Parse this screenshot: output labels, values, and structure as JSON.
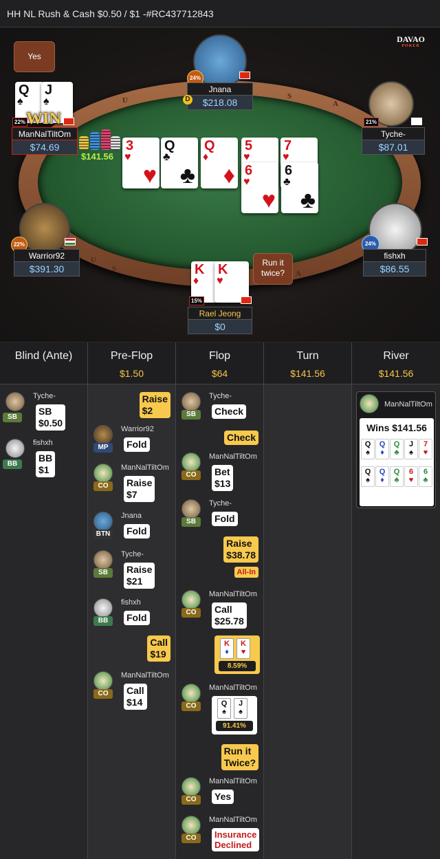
{
  "header": {
    "title": "HH NL Rush & Cash $0.50 / $1 -#RC437712843"
  },
  "logo": {
    "text": "DAVAO",
    "sub": "POKER"
  },
  "rail": {
    "letters": [
      "U",
      "S",
      "A",
      "U",
      "S",
      "A"
    ]
  },
  "board": [
    {
      "rank": "3",
      "suit": "♥",
      "color": "red"
    },
    {
      "rank": "Q",
      "suit": "♣",
      "color": "black"
    },
    {
      "rank": "Q",
      "suit": "♦",
      "color": "red"
    },
    {
      "rank": "5",
      "suit": "♥",
      "color": "red"
    },
    {
      "rank": "7",
      "suit": "♥",
      "color": "red"
    },
    {
      "rank": "6",
      "suit": "♥",
      "color": "red"
    },
    {
      "rank": "6",
      "suit": "♣",
      "color": "black"
    }
  ],
  "seats": {
    "mannal": {
      "name": "ManNalTiltOm",
      "stack": "$74.69",
      "pct": "22%",
      "cards": [
        {
          "rank": "Q",
          "suit": "♠"
        },
        {
          "rank": "J",
          "suit": "♠"
        }
      ],
      "win": "WIN",
      "bubble": "Yes"
    },
    "jnana": {
      "name": "Jnana",
      "stack": "$218.08",
      "pct": "24%"
    },
    "tyche": {
      "name": "Tyche-",
      "stack": "$87.01",
      "pct": "21%"
    },
    "warrior": {
      "name": "Warrior92",
      "stack": "$391.30",
      "pct": "22%"
    },
    "fishxh": {
      "name": "fishxh",
      "stack": "$86.55",
      "pct": "24%"
    },
    "rael": {
      "name": "Rael Jeong",
      "stack": "$0",
      "pct": "15%",
      "cards": [
        {
          "rank": "K",
          "suit": "♦"
        },
        {
          "rank": "K",
          "suit": "♥"
        }
      ],
      "bubble": "Run it twice?"
    }
  },
  "pot_chips": "$141.56",
  "dealer_button": "D",
  "columns": [
    {
      "title": "Blind (Ante)",
      "pot": ""
    },
    {
      "title": "Pre-Flop",
      "pot": "$1.50"
    },
    {
      "title": "Flop",
      "pot": "$64"
    },
    {
      "title": "Turn",
      "pot": "$141.56"
    },
    {
      "title": "River",
      "pot": "$141.56"
    }
  ],
  "blind": [
    {
      "name": "Tyche-",
      "pos": "SB",
      "a1": "SB",
      "a2": "$0.50"
    },
    {
      "name": "fishxh",
      "pos": "BB",
      "a1": "BB",
      "a2": "$1"
    }
  ],
  "preflop": [
    {
      "hero": true,
      "a1": "Raise",
      "a2": "$2"
    },
    {
      "name": "Warrior92",
      "pos": "MP",
      "a1": "Fold"
    },
    {
      "name": "ManNalTiltOm",
      "pos": "CO",
      "a1": "Raise",
      "a2": "$7"
    },
    {
      "name": "Jnana",
      "pos": "BTN",
      "a1": "Fold"
    },
    {
      "name": "Tyche-",
      "pos": "SB",
      "a1": "Raise",
      "a2": "$21"
    },
    {
      "name": "fishxh",
      "pos": "BB",
      "a1": "Fold"
    },
    {
      "hero": true,
      "a1": "Call",
      "a2": "$19"
    },
    {
      "name": "ManNalTiltOm",
      "pos": "CO",
      "a1": "Call",
      "a2": "$14"
    }
  ],
  "flop": [
    {
      "name": "Tyche-",
      "pos": "SB",
      "a1": "Check"
    },
    {
      "hero": true,
      "a1": "Check"
    },
    {
      "name": "ManNalTiltOm",
      "pos": "CO",
      "a1": "Bet",
      "a2": "$13"
    },
    {
      "name": "Tyche-",
      "pos": "SB",
      "a1": "Fold"
    },
    {
      "hero": true,
      "a1": "Raise",
      "a2": "$38.78",
      "allin": "All-In"
    },
    {
      "name": "ManNalTiltOm",
      "pos": "CO",
      "a1": "Call",
      "a2": "$25.78"
    },
    {
      "hero": true,
      "cards": [
        {
          "rank": "K",
          "suit": "♦"
        },
        {
          "rank": "K",
          "suit": "♥"
        }
      ],
      "equity": "8.59%"
    },
    {
      "name": "ManNalTiltOm",
      "pos": "CO",
      "cards": [
        {
          "rank": "Q",
          "suit": "♠"
        },
        {
          "rank": "J",
          "suit": "♠"
        }
      ],
      "equity": "91.41%"
    },
    {
      "hero": true,
      "a1": "Run it",
      "a2": "Twice?"
    },
    {
      "name": "ManNalTiltOm",
      "pos": "CO",
      "a1": "Yes"
    },
    {
      "name": "ManNalTiltOm",
      "pos": "CO",
      "a1": "Insurance",
      "a2": "Declined"
    }
  ],
  "river": {
    "winner": "ManNalTiltOm",
    "wins": "Wins $141.56",
    "row1": [
      {
        "rank": "Q",
        "suit": "♠",
        "c": "black"
      },
      {
        "rank": "Q",
        "suit": "♦",
        "c": "blue"
      },
      {
        "rank": "Q",
        "suit": "♣",
        "c": "green"
      },
      {
        "rank": "J",
        "suit": "♠",
        "c": "black"
      },
      {
        "rank": "7",
        "suit": "♥",
        "c": "red"
      }
    ],
    "row2": [
      {
        "rank": "Q",
        "suit": "♠",
        "c": "black"
      },
      {
        "rank": "Q",
        "suit": "♦",
        "c": "blue"
      },
      {
        "rank": "Q",
        "suit": "♣",
        "c": "green"
      },
      {
        "rank": "6",
        "suit": "♥",
        "c": "red"
      },
      {
        "rank": "6",
        "suit": "♣",
        "c": "green"
      }
    ]
  },
  "colors": {
    "pos_SB": "#5c7a3a",
    "pos_BB": "#3d7a4e",
    "pos_MP": "#2f4a78",
    "pos_CO": "#8a6a1a",
    "pos_BTN": "#333333",
    "gold": "#f8c94c",
    "stack_blue": "#9fd3ff"
  }
}
